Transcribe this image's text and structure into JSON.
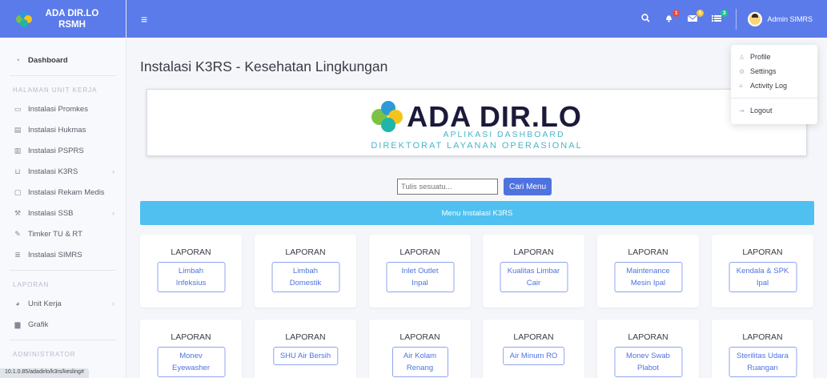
{
  "brand": {
    "line1": "ADA DIR.LO",
    "line2": "RSMH"
  },
  "sidebar": {
    "dashboard": "Dashboard",
    "heading_unit": "HALAMAN UNIT KERJA",
    "items": [
      {
        "label": "Instalasi Promkes",
        "icon": "window-icon"
      },
      {
        "label": "Instalasi Hukmas",
        "icon": "document-icon"
      },
      {
        "label": "Instalasi PSPRS",
        "icon": "table-icon"
      },
      {
        "label": "Instalasi K3RS",
        "icon": "sink-icon",
        "chevron": true
      },
      {
        "label": "Instalasi Rekam Medis",
        "icon": "monitor-icon"
      },
      {
        "label": "Instalasi SSB",
        "icon": "tools-icon",
        "chevron": true
      },
      {
        "label": "Timker TU & RT",
        "icon": "edit-icon"
      },
      {
        "label": "Instalasi SIMRS",
        "icon": "database-icon"
      }
    ],
    "heading_laporan": "LAPORAN",
    "laporan_items": [
      {
        "label": "Unit Kerja",
        "icon": "pie-icon",
        "chevron": true
      },
      {
        "label": "Grafik",
        "icon": "bar-chart-icon"
      }
    ],
    "heading_admin": "ADMINISTRATOR"
  },
  "statusbar_url": "10.1.0.85/adadirlo/k3rs/kesling#",
  "topbar": {
    "badges": {
      "alerts": "1",
      "messages": "5",
      "tasks": "3"
    },
    "username": "Admin SIMRS"
  },
  "user_menu": {
    "profile": "Profile",
    "settings": "Settings",
    "activity": "Activity Log",
    "logout": "Logout"
  },
  "page_title": "Instalasi K3RS - Kesehatan Lingkungan",
  "banner": {
    "title": "ADA DIR.LO",
    "sub1": "APLIKASI DASHBOARD",
    "sub2": "DIREKTORAT LAYANAN OPERASIONAL"
  },
  "search": {
    "placeholder": "Tulis sesuatu...",
    "button": "Cari Menu"
  },
  "menu_title": "Menu Instalasi K3RS",
  "cards_row1": [
    {
      "title": "LAPORAN",
      "button": "Limbah Infeksius"
    },
    {
      "title": "LAPORAN",
      "button": "Limbah Domestik"
    },
    {
      "title": "LAPORAN",
      "button": "Inlet Outlet Inpal"
    },
    {
      "title": "LAPORAN",
      "button": "Kualitas Limbar Cair"
    },
    {
      "title": "LAPORAN",
      "button": "Maintenance Mesin Ipal"
    },
    {
      "title": "LAPORAN",
      "button": "Kendala & SPK Ipal"
    }
  ],
  "cards_row2": [
    {
      "title": "LAPORAN",
      "button": "Monev Eyewasher"
    },
    {
      "title": "LAPORAN",
      "button": "SHU Air Bersih"
    },
    {
      "title": "LAPORAN",
      "button": "Air Kolam Renang"
    },
    {
      "title": "LAPORAN",
      "button": "Air Minum RO"
    },
    {
      "title": "LAPORAN",
      "button": "Monev Swab Plabot"
    },
    {
      "title": "LAPORAN",
      "button": "Sterilitas Udara Ruangan"
    }
  ],
  "colors": {
    "primary": "#5b7bea",
    "info": "#4fc0f0",
    "logo_green": "#7cc242",
    "logo_blue": "#2e9ad6",
    "logo_yellow": "#f5c41a",
    "logo_teal": "#1fb5a9"
  }
}
